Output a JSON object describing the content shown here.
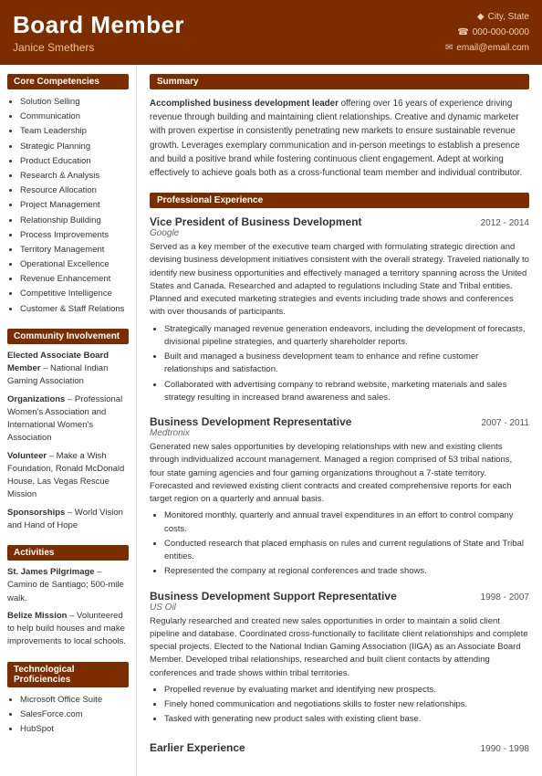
{
  "header": {
    "name": "Board Member",
    "subtitle": "Janice Smethers",
    "contact": {
      "location": "City, State",
      "phone": "000-000-0000",
      "email": "email@email.com"
    }
  },
  "sidebar": {
    "core_competencies_title": "Core Competencies",
    "core_competencies": [
      "Solution Selling",
      "Communication",
      "Team Leadership",
      "Strategic Planning",
      "Product Education",
      "Research & Analysis",
      "Resource Allocation",
      "Project Management",
      "Relationship Building",
      "Process Improvements",
      "Territory Management",
      "Operational Excellence",
      "Revenue Enhancement",
      "Competitive Intelligence",
      "Customer & Staff Relations"
    ],
    "community_title": "Community Involvement",
    "community_items": [
      {
        "label": "Elected Associate Board Member",
        "text": " – National Indian Gaming Association"
      },
      {
        "label": "Organizations",
        "text": " – Professional Women's Association and International Women's Association"
      },
      {
        "label": "Volunteer",
        "text": " – Make a Wish Foundation, Ronald McDonald House, Las Vegas Rescue Mission"
      },
      {
        "label": "Sponsorships",
        "text": " – World Vision and Hand of Hope"
      }
    ],
    "activities_title": "Activities",
    "activities_items": [
      {
        "label": "St. James Pilgrimage",
        "text": " – Camino de Santiago; 500-mile walk."
      },
      {
        "label": "Belize Mission",
        "text": " – Volunteered to help build houses and make improvements to local schools."
      }
    ],
    "tech_title": "Technological Proficiencies",
    "tech_items": [
      "Microsoft Office Suite",
      "SalesForce.com",
      "HubSpot"
    ]
  },
  "content": {
    "summary_title": "Summary",
    "summary_bold": "Accomplished business development leader",
    "summary_rest": " offering over 16 years of experience driving revenue through building and maintaining client relationships. Creative and dynamic marketer with proven expertise in consistently penetrating new markets to ensure sustainable revenue growth. Leverages exemplary communication and in-person meetings to establish a presence and build a positive brand while fostering continuous client engagement. Adept at working effectively to achieve goals both as a cross-functional team member and individual contributor.",
    "experience_title": "Professional Experience",
    "jobs": [
      {
        "title": "Vice President of Business Development",
        "dates": "2012 - 2014",
        "company": "Google",
        "description": "Served as a key member of the executive team charged with formulating strategic direction and devising business development initiatives consistent with the overall strategy. Traveled nationally to identify new business opportunities and effectively managed a territory spanning across the United States and Canada. Researched and adapted to regulations including State and Tribal entities. Planned and executed marketing strategies and events including trade shows and conferences with over thousands of participants.",
        "bullets": [
          "Strategically managed revenue generation endeavors, including the development of forecasts, divisional pipeline strategies, and quarterly shareholder reports.",
          "Built and managed a business development team to enhance and refine customer relationships and satisfaction.",
          "Collaborated with advertising company to rebrand website, marketing materials and sales strategy resulting in increased brand awareness and sales."
        ]
      },
      {
        "title": "Business Development Representative",
        "dates": "2007 - 2011",
        "company": "Medtronix",
        "description": "Generated new sales opportunities by developing relationships with new and existing clients through individualized account management. Managed a region comprised of 53 tribal nations, four state gaming agencies and four gaming organizations throughout a 7-state territory. Forecasted and reviewed existing client contracts and created comprehensive reports for each target region on a quarterly and annual basis.",
        "bullets": [
          "Monitored monthly, quarterly and annual travel expenditures in an effort to control company costs.",
          "Conducted research that placed emphasis on rules and current regulations of State and Tribal entities.",
          "Represented the company at regional conferences and trade shows."
        ]
      },
      {
        "title": "Business Development Support Representative",
        "dates": "1998 - 2007",
        "company": "US Oil",
        "description": "Regularly researched and created new sales opportunities in order to maintain a solid client pipeline and database. Coordinated cross-functionally to facilitate client relationships and complete special projects. Elected to the National Indian Gaming Association (IIGA) as an Associate Board Member. Developed tribal relationships, researched and built client contacts by attending conferences and trade shows within tribal territories.",
        "bullets": [
          "Propelled revenue by evaluating market and identifying new prospects.",
          "Finely honed communication and negotiations skills to foster new relationships.",
          "Tasked with generating new product sales with existing client base."
        ]
      }
    ],
    "earlier_experience_title": "Earlier Experience",
    "earlier_dates": "1990 - 1998"
  }
}
